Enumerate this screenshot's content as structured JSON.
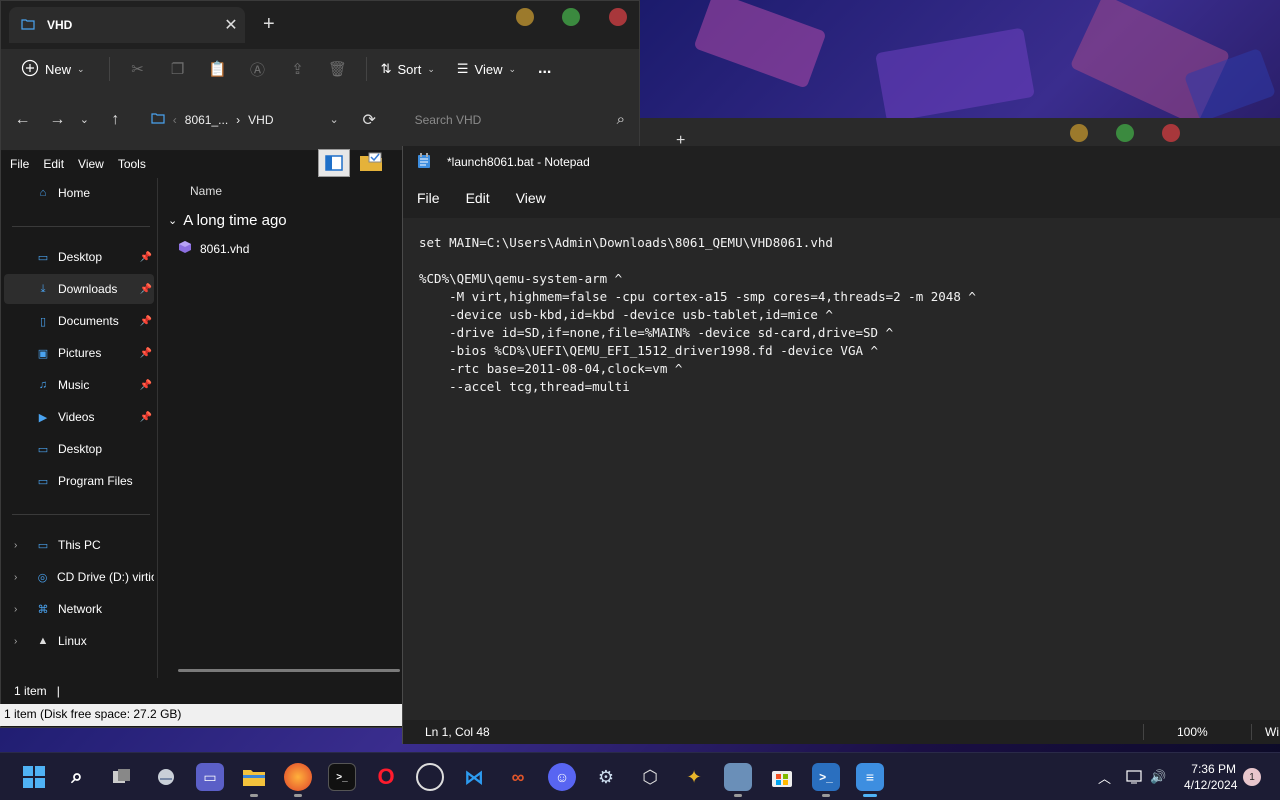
{
  "explorer": {
    "tab_title": "VHD",
    "toolbar": {
      "new_label": "New",
      "sort_label": "Sort",
      "view_label": "View",
      "more_label": "..."
    },
    "address": {
      "crumb_parent": "8061_...",
      "crumb_current": "VHD",
      "search_placeholder": "Search VHD"
    },
    "menubar": [
      "File",
      "Edit",
      "View",
      "Tools"
    ],
    "nav": {
      "home": "Home",
      "quick_access": [
        "Desktop",
        "Downloads",
        "Documents",
        "Pictures",
        "Music",
        "Videos",
        "Desktop",
        "Program Files"
      ],
      "drives": [
        "This PC",
        "CD Drive (D:) virtio-",
        "Network",
        "Linux"
      ]
    },
    "content": {
      "column_name": "Name",
      "group_label": "A long time ago",
      "files": [
        "8061.vhd"
      ]
    },
    "status_count": "1 item",
    "status_bar": "1 item (Disk free space: 27.2 GB)"
  },
  "notepad": {
    "title": "*launch8061.bat - Notepad",
    "menu": [
      "File",
      "Edit",
      "View"
    ],
    "text": "set MAIN=C:\\Users\\Admin\\Downloads\\8061_QEMU\\VHD8061.vhd\n\n%CD%\\QEMU\\qemu-system-arm ^\n    -M virt,highmem=false -cpu cortex-a15 -smp cores=4,threads=2 -m 2048 ^\n    -device usb-kbd,id=kbd -device usb-tablet,id=mice ^\n    -drive id=SD,if=none,file=%MAIN% -device sd-card,drive=SD ^\n    -bios %CD%\\UEFI\\QEMU_EFI_1512_driver1998.fd -device VGA ^\n    -rtc base=2011-08-04,clock=vm ^\n    --accel tcg,thread=multi",
    "status_position": "Ln 1, Col 48",
    "status_zoom": "100%",
    "status_eol": "Wi"
  },
  "taskbar": {
    "time": "7:36 PM",
    "date": "4/12/2024",
    "notification_count": "1",
    "apps": [
      "start-icon",
      "search-icon",
      "task-view-icon",
      "onedrive-icon",
      "teams-icon",
      "file-explorer-icon",
      "firefox-icon",
      "terminal-icon",
      "opera-icon",
      "obs-icon",
      "vscode-icon",
      "rstudio-icon",
      "discord-icon",
      "steam-icon",
      "virtualbox-icon",
      "archive-icon",
      "paint-icon",
      "store-icon",
      "powershell-icon",
      "notepad-icon"
    ]
  },
  "colors": {
    "accent": "#4aa3f0",
    "window_bg": "#191919",
    "notepad_bg": "#272727",
    "taskbar_bg": "#1c1c34"
  }
}
